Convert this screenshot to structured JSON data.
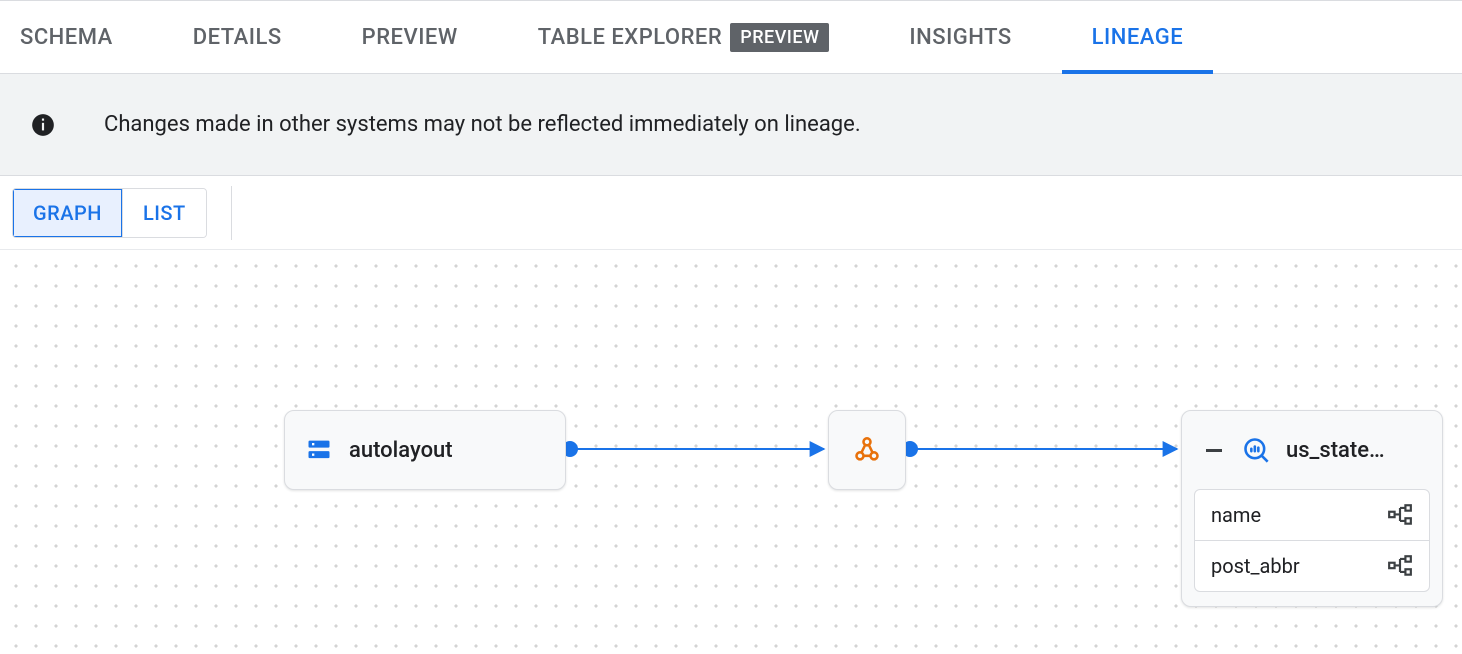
{
  "tabs": {
    "schema": "SCHEMA",
    "details": "DETAILS",
    "preview": "PREVIEW",
    "explorer": "TABLE EXPLORER",
    "explorer_badge": "PREVIEW",
    "insights": "INSIGHTS",
    "lineage": "LINEAGE"
  },
  "banner": {
    "message": "Changes made in other systems may not be reflected immediately on lineage."
  },
  "view_toggle": {
    "graph": "GRAPH",
    "list": "LIST"
  },
  "graph": {
    "source": {
      "label": "autolayout",
      "icon": "bigquery-table-icon"
    },
    "process": {
      "icon": "dataflow-process-icon"
    },
    "target": {
      "label": "us_state…",
      "icon": "bigquery-lens-icon",
      "columns": [
        "name",
        "post_abbr"
      ]
    }
  },
  "colors": {
    "accent": "#1a73e8",
    "process": "#e8710a"
  }
}
